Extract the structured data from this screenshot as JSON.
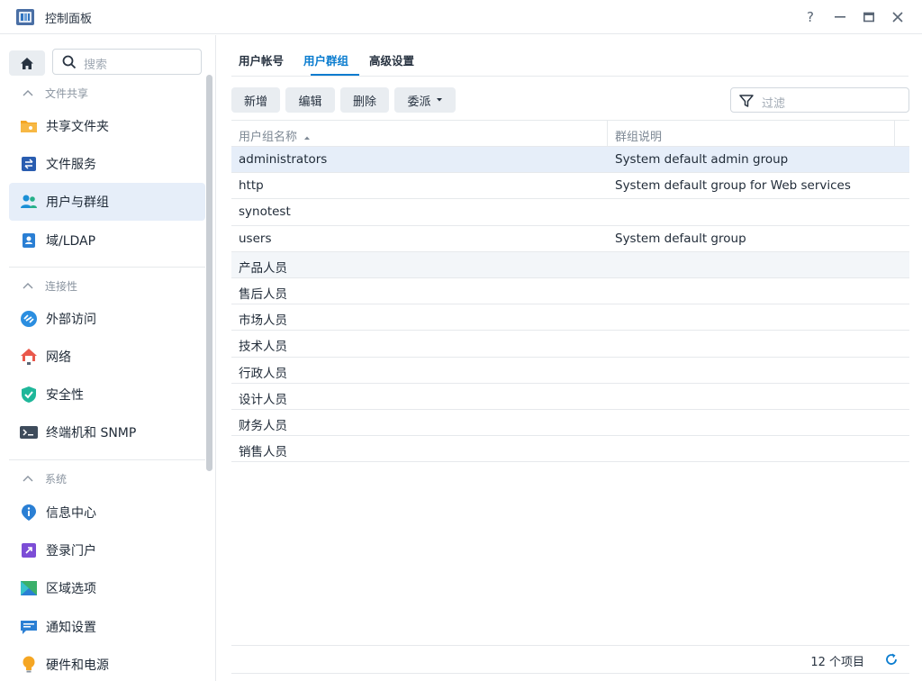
{
  "window": {
    "title": "控制面板",
    "help": "?",
    "minimize": "—",
    "maximize": "▭",
    "close": "✕"
  },
  "sidebar": {
    "search_placeholder": "搜索",
    "sections": [
      {
        "title": "文件共享",
        "items": [
          {
            "label": "共享文件夹",
            "icon": "shared-folder-icon"
          },
          {
            "label": "文件服务",
            "icon": "file-services-icon"
          },
          {
            "label": "用户与群组",
            "icon": "users-groups-icon",
            "active": true
          },
          {
            "label": "域/LDAP",
            "icon": "domain-ldap-icon"
          }
        ]
      },
      {
        "title": "连接性",
        "items": [
          {
            "label": "外部访问",
            "icon": "external-access-icon"
          },
          {
            "label": "网络",
            "icon": "network-icon"
          },
          {
            "label": "安全性",
            "icon": "security-icon"
          },
          {
            "label": "终端机和 SNMP",
            "icon": "terminal-icon"
          }
        ]
      },
      {
        "title": "系统",
        "items": [
          {
            "label": "信息中心",
            "icon": "info-center-icon"
          },
          {
            "label": "登录门户",
            "icon": "login-portal-icon"
          },
          {
            "label": "区域选项",
            "icon": "regional-options-icon"
          },
          {
            "label": "通知设置",
            "icon": "notification-icon"
          },
          {
            "label": "硬件和电源",
            "icon": "hardware-power-icon"
          }
        ]
      }
    ]
  },
  "tabs": [
    "用户帐号",
    "用户群组",
    "高级设置"
  ],
  "active_tab": "用户群组",
  "toolbar": {
    "create": "新增",
    "edit": "编辑",
    "delete": "删除",
    "delegate": "委派",
    "filter_placeholder": "过滤"
  },
  "grid": {
    "columns": [
      "用户组名称",
      "群组说明"
    ],
    "sort_indicator": "▲",
    "rows": [
      {
        "name": "administrators",
        "desc": "System default admin group"
      },
      {
        "name": "http",
        "desc": "System default group for Web services"
      },
      {
        "name": "synotest",
        "desc": ""
      },
      {
        "name": "users",
        "desc": "System default group"
      },
      {
        "name": "产品人员",
        "desc": ""
      },
      {
        "name": "售后人员",
        "desc": ""
      },
      {
        "name": "市场人员",
        "desc": ""
      },
      {
        "name": "技术人员",
        "desc": ""
      },
      {
        "name": "行政人员",
        "desc": ""
      },
      {
        "name": "设计人员",
        "desc": ""
      },
      {
        "name": "财务人员",
        "desc": ""
      },
      {
        "name": "销售人员",
        "desc": ""
      }
    ]
  },
  "footer": {
    "count": "12 个项目"
  },
  "colors": {
    "accent": "#0a7ccf",
    "selected_row": "#e6eef9"
  }
}
